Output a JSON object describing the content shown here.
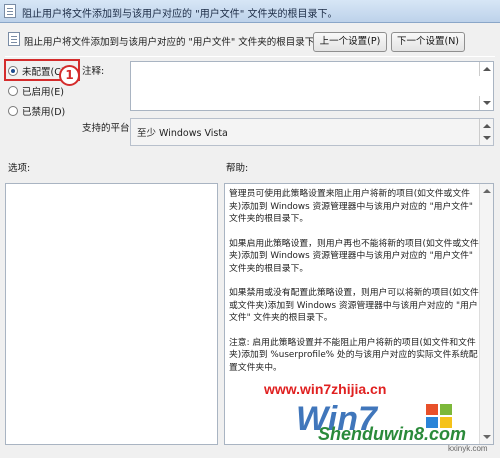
{
  "window": {
    "title": "阻止用户将文件添加到与该用户对应的 \"用户文件\" 文件夹的根目录下。"
  },
  "header": {
    "title": "阻止用户将文件添加到与该用户对应的 \"用户文件\" 文件夹的根目录下。"
  },
  "buttons": {
    "prev": "上一个设置(P)",
    "next": "下一个设置(N)"
  },
  "radios": [
    {
      "label": "未配置(C)",
      "checked": true
    },
    {
      "label": "已启用(E)",
      "checked": false
    },
    {
      "label": "已禁用(D)",
      "checked": false
    }
  ],
  "annotation_badge": "1",
  "comment": {
    "label": "注释:",
    "value": ""
  },
  "platform": {
    "label": "支持的平台:",
    "value": "至少 Windows Vista"
  },
  "options": {
    "label": "选项:"
  },
  "help": {
    "label": "帮助:",
    "paragraphs": [
      "管理员可使用此策略设置来阻止用户将新的项目(如文件或文件夹)添加到 Windows 资源管理器中与该用户对应的 \"用户文件\" 文件夹的根目录下。",
      "如果启用此策略设置，则用户再也不能将新的项目(如文件或文件夹)添加到 Windows 资源管理器中与该用户对应的 \"用户文件\" 文件夹的根目录下。",
      "如果禁用或没有配置此策略设置，则用户可以将新的项目(如文件或文件夹)添加到 Windows 资源管理器中与该用户对应的 \"用户文件\" 文件夹的根目录下。",
      "注意: 启用此策略设置并不能阻止用户将新的项目(如文件和文件夹)添加到 %userprofile% 处的与该用户对应的实际文件系统配置文件夹中。"
    ]
  },
  "watermark": {
    "url": "www.win7zhijia.cn",
    "logo": "Win7",
    "site2": "Shenduwin8.com",
    "small": "kxinyk.com"
  },
  "colors": {
    "highlight": "#d42c2c",
    "titlebar": "#bdd2ea"
  }
}
